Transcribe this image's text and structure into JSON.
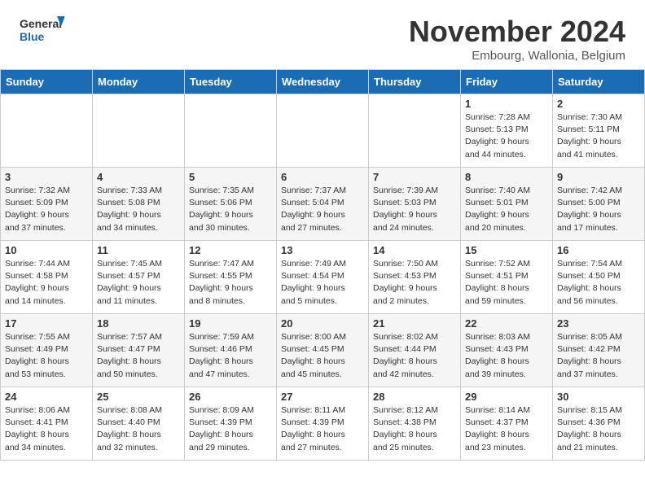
{
  "header": {
    "logo_line1": "General",
    "logo_line2": "Blue",
    "month": "November 2024",
    "location": "Embourg, Wallonia, Belgium"
  },
  "weekdays": [
    "Sunday",
    "Monday",
    "Tuesday",
    "Wednesday",
    "Thursday",
    "Friday",
    "Saturday"
  ],
  "weeks": [
    [
      {
        "day": "",
        "info": ""
      },
      {
        "day": "",
        "info": ""
      },
      {
        "day": "",
        "info": ""
      },
      {
        "day": "",
        "info": ""
      },
      {
        "day": "",
        "info": ""
      },
      {
        "day": "1",
        "info": "Sunrise: 7:28 AM\nSunset: 5:13 PM\nDaylight: 9 hours\nand 44 minutes."
      },
      {
        "day": "2",
        "info": "Sunrise: 7:30 AM\nSunset: 5:11 PM\nDaylight: 9 hours\nand 41 minutes."
      }
    ],
    [
      {
        "day": "3",
        "info": "Sunrise: 7:32 AM\nSunset: 5:09 PM\nDaylight: 9 hours\nand 37 minutes."
      },
      {
        "day": "4",
        "info": "Sunrise: 7:33 AM\nSunset: 5:08 PM\nDaylight: 9 hours\nand 34 minutes."
      },
      {
        "day": "5",
        "info": "Sunrise: 7:35 AM\nSunset: 5:06 PM\nDaylight: 9 hours\nand 30 minutes."
      },
      {
        "day": "6",
        "info": "Sunrise: 7:37 AM\nSunset: 5:04 PM\nDaylight: 9 hours\nand 27 minutes."
      },
      {
        "day": "7",
        "info": "Sunrise: 7:39 AM\nSunset: 5:03 PM\nDaylight: 9 hours\nand 24 minutes."
      },
      {
        "day": "8",
        "info": "Sunrise: 7:40 AM\nSunset: 5:01 PM\nDaylight: 9 hours\nand 20 minutes."
      },
      {
        "day": "9",
        "info": "Sunrise: 7:42 AM\nSunset: 5:00 PM\nDaylight: 9 hours\nand 17 minutes."
      }
    ],
    [
      {
        "day": "10",
        "info": "Sunrise: 7:44 AM\nSunset: 4:58 PM\nDaylight: 9 hours\nand 14 minutes."
      },
      {
        "day": "11",
        "info": "Sunrise: 7:45 AM\nSunset: 4:57 PM\nDaylight: 9 hours\nand 11 minutes."
      },
      {
        "day": "12",
        "info": "Sunrise: 7:47 AM\nSunset: 4:55 PM\nDaylight: 9 hours\nand 8 minutes."
      },
      {
        "day": "13",
        "info": "Sunrise: 7:49 AM\nSunset: 4:54 PM\nDaylight: 9 hours\nand 5 minutes."
      },
      {
        "day": "14",
        "info": "Sunrise: 7:50 AM\nSunset: 4:53 PM\nDaylight: 9 hours\nand 2 minutes."
      },
      {
        "day": "15",
        "info": "Sunrise: 7:52 AM\nSunset: 4:51 PM\nDaylight: 8 hours\nand 59 minutes."
      },
      {
        "day": "16",
        "info": "Sunrise: 7:54 AM\nSunset: 4:50 PM\nDaylight: 8 hours\nand 56 minutes."
      }
    ],
    [
      {
        "day": "17",
        "info": "Sunrise: 7:55 AM\nSunset: 4:49 PM\nDaylight: 8 hours\nand 53 minutes."
      },
      {
        "day": "18",
        "info": "Sunrise: 7:57 AM\nSunset: 4:47 PM\nDaylight: 8 hours\nand 50 minutes."
      },
      {
        "day": "19",
        "info": "Sunrise: 7:59 AM\nSunset: 4:46 PM\nDaylight: 8 hours\nand 47 minutes."
      },
      {
        "day": "20",
        "info": "Sunrise: 8:00 AM\nSunset: 4:45 PM\nDaylight: 8 hours\nand 45 minutes."
      },
      {
        "day": "21",
        "info": "Sunrise: 8:02 AM\nSunset: 4:44 PM\nDaylight: 8 hours\nand 42 minutes."
      },
      {
        "day": "22",
        "info": "Sunrise: 8:03 AM\nSunset: 4:43 PM\nDaylight: 8 hours\nand 39 minutes."
      },
      {
        "day": "23",
        "info": "Sunrise: 8:05 AM\nSunset: 4:42 PM\nDaylight: 8 hours\nand 37 minutes."
      }
    ],
    [
      {
        "day": "24",
        "info": "Sunrise: 8:06 AM\nSunset: 4:41 PM\nDaylight: 8 hours\nand 34 minutes."
      },
      {
        "day": "25",
        "info": "Sunrise: 8:08 AM\nSunset: 4:40 PM\nDaylight: 8 hours\nand 32 minutes."
      },
      {
        "day": "26",
        "info": "Sunrise: 8:09 AM\nSunset: 4:39 PM\nDaylight: 8 hours\nand 29 minutes."
      },
      {
        "day": "27",
        "info": "Sunrise: 8:11 AM\nSunset: 4:39 PM\nDaylight: 8 hours\nand 27 minutes."
      },
      {
        "day": "28",
        "info": "Sunrise: 8:12 AM\nSunset: 4:38 PM\nDaylight: 8 hours\nand 25 minutes."
      },
      {
        "day": "29",
        "info": "Sunrise: 8:14 AM\nSunset: 4:37 PM\nDaylight: 8 hours\nand 23 minutes."
      },
      {
        "day": "30",
        "info": "Sunrise: 8:15 AM\nSunset: 4:36 PM\nDaylight: 8 hours\nand 21 minutes."
      }
    ]
  ]
}
